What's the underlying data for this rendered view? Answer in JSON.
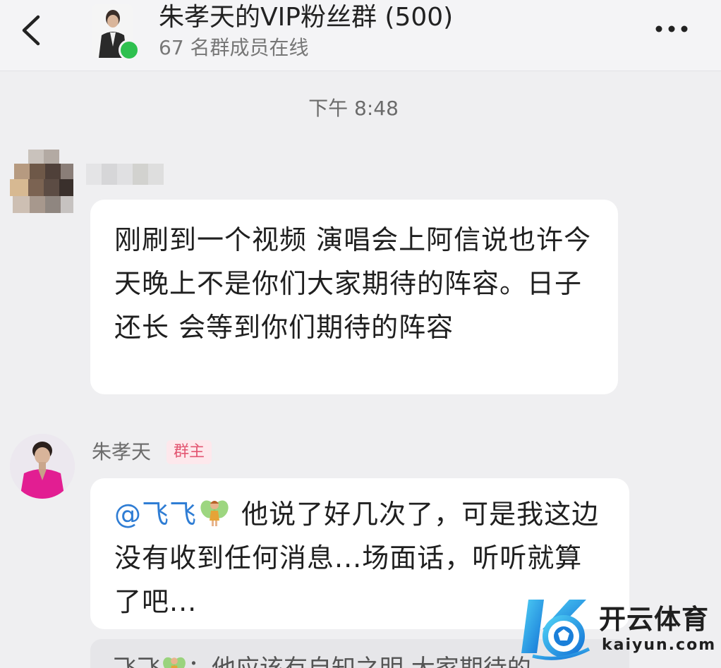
{
  "header": {
    "back_icon": "chevron-left-icon",
    "group_name": "朱孝天的VIP粉丝群 (500)",
    "online_status": "67 名群成员在线",
    "more_icon": "more-horizontal-icon",
    "online_color": "#2ec04f"
  },
  "chat": {
    "timestamp": "下午 8:48",
    "messages": [
      {
        "sender": "",
        "avatar": "blurred-avatar",
        "text": "刚刷到一个视频 演唱会上阿信说也许今天晚上不是你们大家期待的阵容。日子还长 会等到你们期待的阵容"
      },
      {
        "sender": "朱孝天",
        "role": "群主",
        "avatar": "owner-avatar",
        "mention": "@飞飞",
        "mention_icon": "fairy-emoji-icon",
        "text": " 他说了好几次了，可是我这边没有收到任何消息...场面话，听听就算了吧..."
      }
    ],
    "quote": {
      "name": "飞飞",
      "text": "：他应该有自知之明  大家期待的"
    }
  },
  "watermark": {
    "cn": "开云体育",
    "en": "kaiyun.com",
    "brand_color": "#1ea1e8"
  }
}
